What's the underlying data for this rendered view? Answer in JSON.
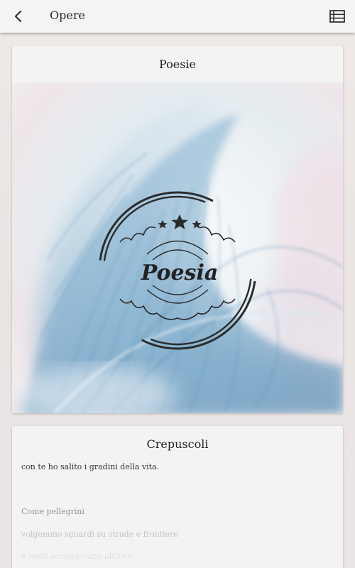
{
  "appbar": {
    "title": "Opere",
    "back_icon": "chevron-left-icon",
    "menu_icon": "list-view-icon"
  },
  "cards": [
    {
      "title": "Poesie",
      "cover": {
        "stamp_text": "Poesia",
        "stars": 3
      }
    },
    {
      "title": "Crepuscoli",
      "lines": [
        "con te ho salito i gradini della vita.",
        "",
        "Come pellegrini",
        "volgemmo sguardi su strade e frontiere",
        "e venti accendevano altrove"
      ]
    }
  ],
  "colors": {
    "appbar": "#f4f4f4",
    "card": "#f3f3f3",
    "feather_blue": "#5f98bf",
    "stamp": "#2b2b2b"
  }
}
